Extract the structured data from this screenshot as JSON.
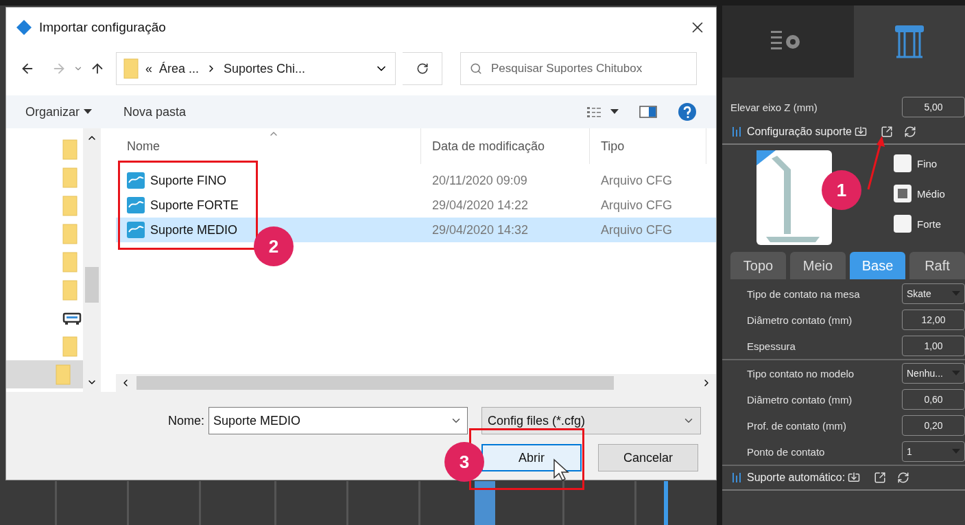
{
  "dialog": {
    "title": "Importar configuração",
    "breadcrumbs": [
      "«",
      "Área ...",
      "Suportes Chi..."
    ],
    "search": {
      "placeholder": "Pesquisar Suportes Chitubox"
    },
    "toolbar": {
      "organize": "Organizar",
      "new_folder": "Nova pasta"
    },
    "nav_items": [
      {
        "kind": "folder",
        "selected": false
      },
      {
        "kind": "folder",
        "selected": false
      },
      {
        "kind": "folder",
        "selected": false
      },
      {
        "kind": "folder",
        "selected": false
      },
      {
        "kind": "folder",
        "selected": false
      },
      {
        "kind": "folder",
        "selected": false
      },
      {
        "kind": "drive",
        "selected": false
      },
      {
        "kind": "folder",
        "selected": false
      },
      {
        "kind": "folder",
        "selected": true
      }
    ],
    "columns": [
      {
        "label": "Nome",
        "sorted": true
      },
      {
        "label": "Data de modificação",
        "sorted": false
      },
      {
        "label": "Tipo",
        "sorted": false
      }
    ],
    "files": [
      {
        "name": "Suporte FINO",
        "modified": "20/11/2020 09:09",
        "type": "Arquivo CFG",
        "selected": false
      },
      {
        "name": "Suporte FORTE",
        "modified": "29/04/2020 14:22",
        "type": "Arquivo CFG",
        "selected": false
      },
      {
        "name": "Suporte MEDIO",
        "modified": "29/04/2020 14:32",
        "type": "Arquivo CFG",
        "selected": true
      }
    ],
    "filename": {
      "label": "Nome:",
      "value": "Suporte MEDIO"
    },
    "filter": "Config files (*.cfg)",
    "buttons": [
      {
        "label": "Abrir",
        "default": true
      },
      {
        "label": "Cancelar",
        "default": false
      }
    ]
  },
  "panel": {
    "tabs": [
      {
        "kind": "settings",
        "selected": false
      },
      {
        "kind": "supports",
        "selected": true
      }
    ],
    "raise_z": {
      "label": "Elevar eixo Z (mm)",
      "value": "5,00"
    },
    "preset_section": "Configuração suporte",
    "presets": [
      {
        "label": "Fino",
        "checked": false
      },
      {
        "label": "Médio",
        "checked": true
      },
      {
        "label": "Forte",
        "checked": false
      }
    ],
    "subtabs": [
      {
        "label": "Topo",
        "selected": false
      },
      {
        "label": "Meio",
        "selected": false
      },
      {
        "label": "Base",
        "selected": true
      },
      {
        "label": "Raft",
        "selected": false
      }
    ],
    "setting_groups": [
      [
        {
          "kind": "select",
          "label": "Tipo de contato na mesa",
          "value": "Skate"
        },
        {
          "kind": "number",
          "label": "Diâmetro contato (mm)",
          "value": "12,00"
        },
        {
          "kind": "number",
          "label": "Espessura",
          "value": "1,00"
        }
      ],
      [
        {
          "kind": "select",
          "label": "Tipo contato no modelo",
          "value": "Nenhu..."
        },
        {
          "kind": "number",
          "label": "Diâmetro contato (mm)",
          "value": "0,60"
        },
        {
          "kind": "number",
          "label": "Prof. de contato (mm)",
          "value": "0,20"
        },
        {
          "kind": "select",
          "label": "Ponto de contato",
          "value": "1"
        }
      ]
    ],
    "auto_section": "Suporte automático:"
  },
  "annotations": [
    {
      "number": "1"
    },
    {
      "number": "2"
    },
    {
      "number": "3"
    }
  ]
}
